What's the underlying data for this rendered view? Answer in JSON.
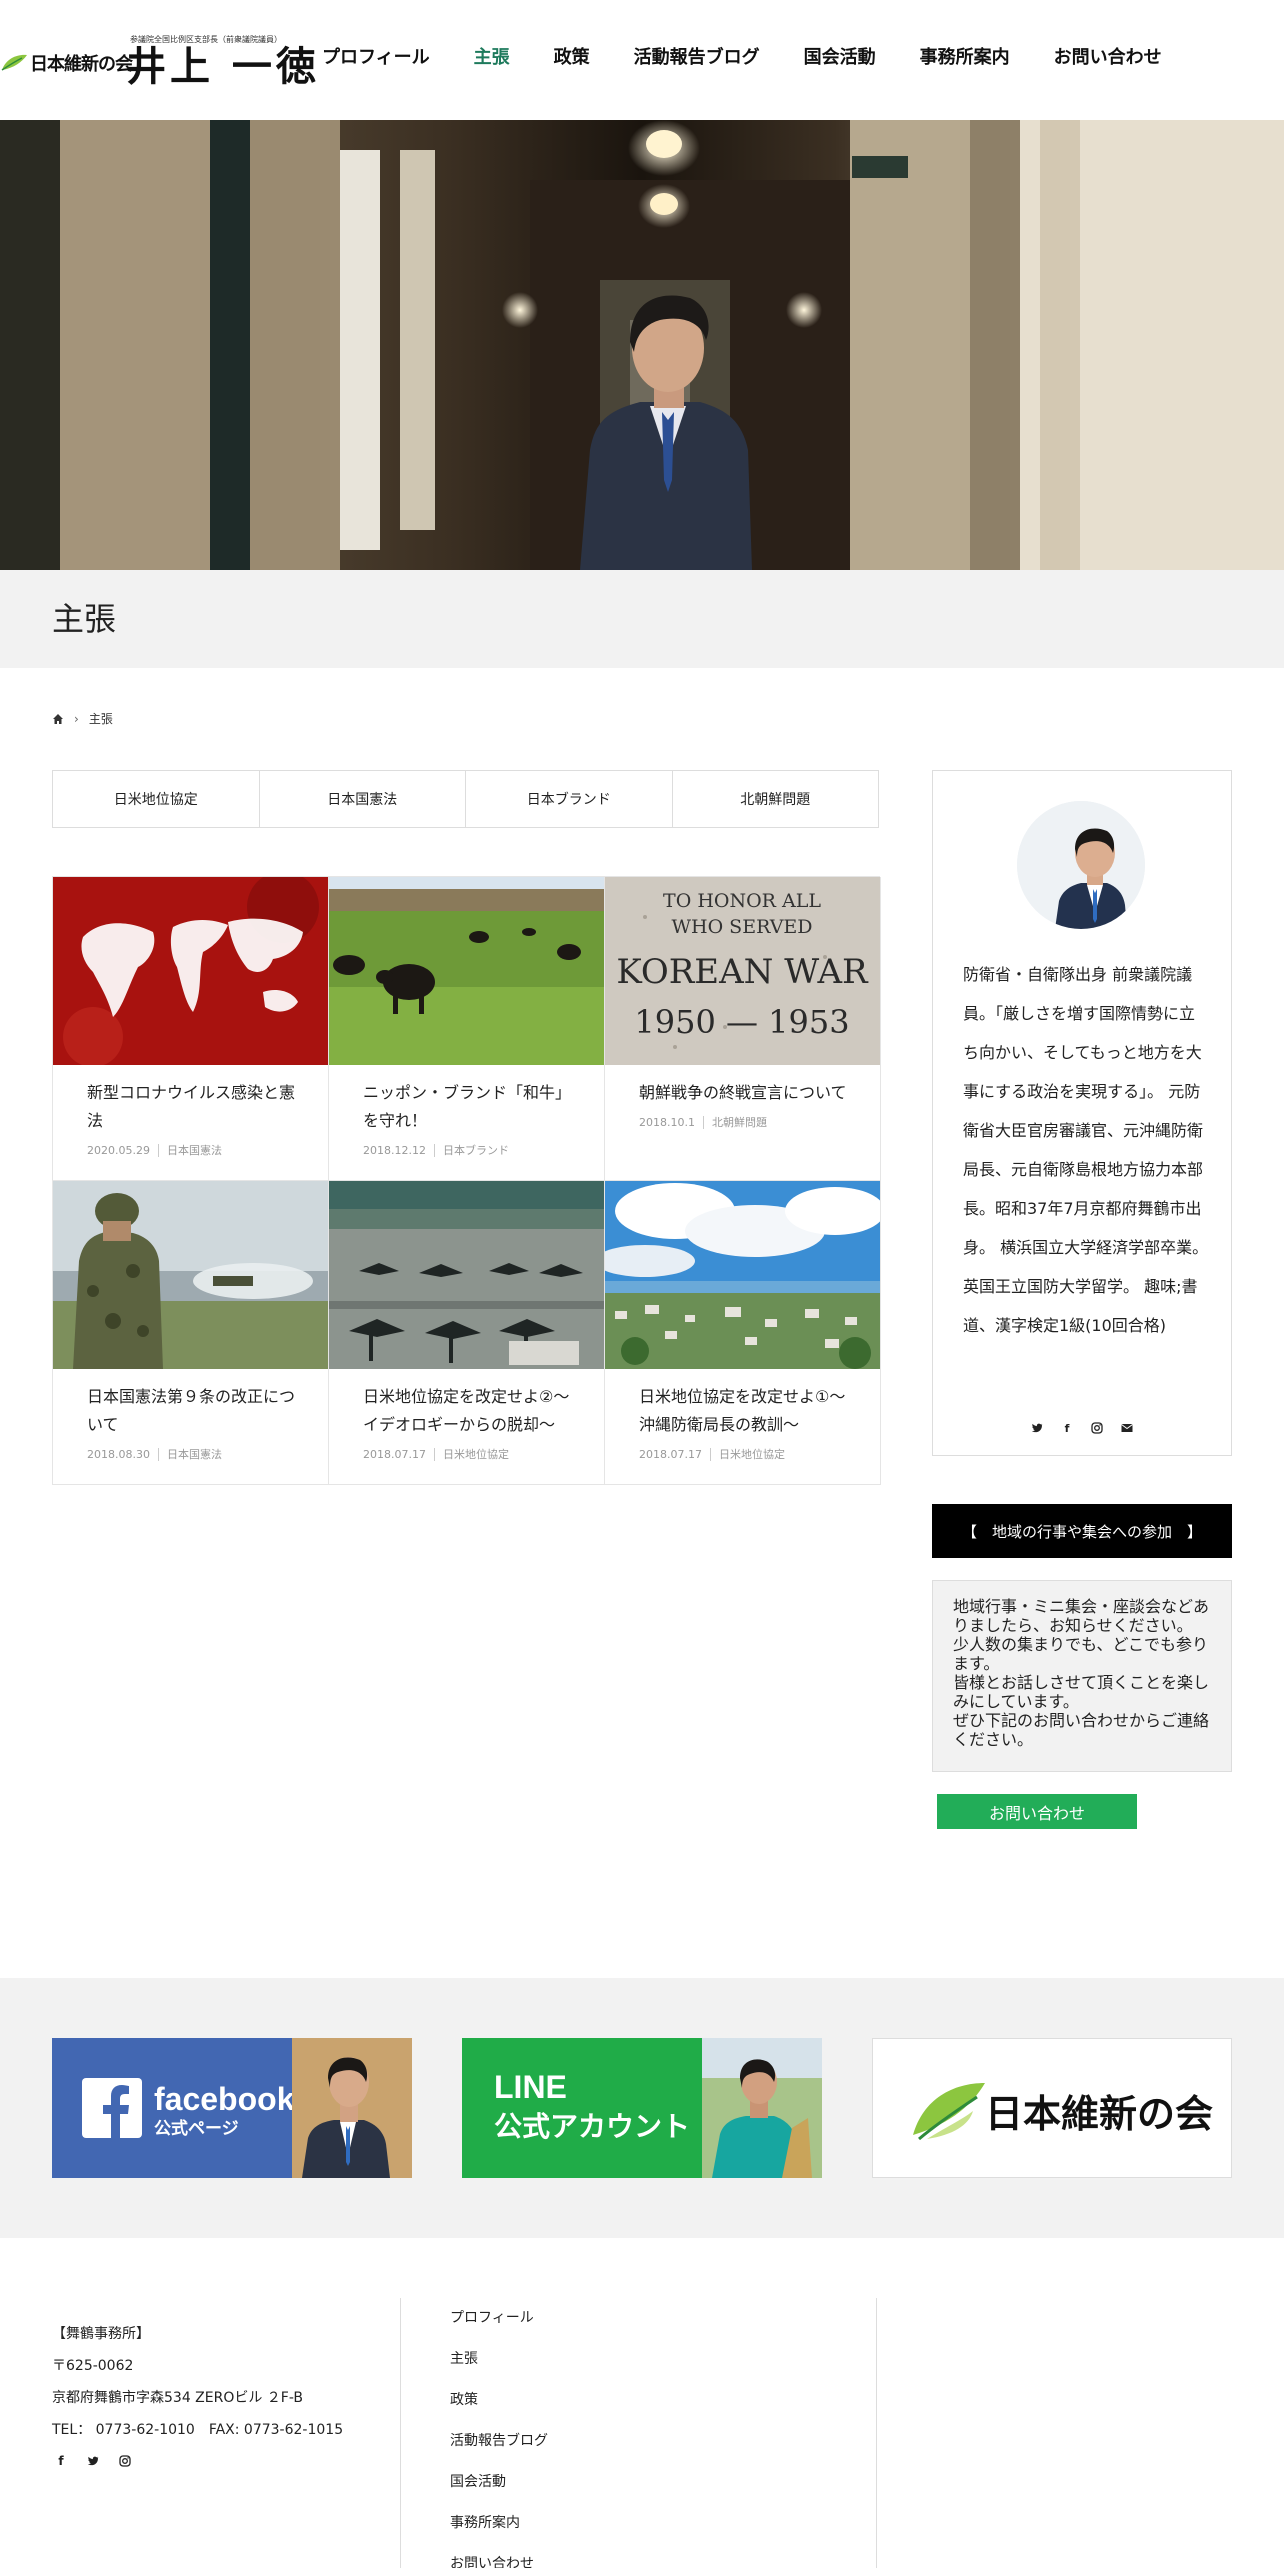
{
  "header": {
    "party_name": "日本維新の会",
    "subtitle": "参議院全国比例区支部長（前衆議院議員）",
    "politician_name": "井上 一徳",
    "nav": [
      {
        "label": "プロフィール",
        "active": false
      },
      {
        "label": "主張",
        "active": true
      },
      {
        "label": "政策",
        "active": false
      },
      {
        "label": "活動報告ブログ",
        "active": false
      },
      {
        "label": "国会活動",
        "active": false
      },
      {
        "label": "事務所案内",
        "active": false
      },
      {
        "label": "お問い合わせ",
        "active": false
      }
    ]
  },
  "page_title": "主張",
  "breadcrumb": {
    "current": "主張"
  },
  "categories": [
    "日米地位協定",
    "日本国憲法",
    "日本ブランド",
    "北朝鮮問題"
  ],
  "posts": [
    {
      "title": "新型コロナウイルス感染と憲法",
      "date": "2020.05.29",
      "category": "日本国憲法",
      "image": "covid-map"
    },
    {
      "title": "ニッポン・ブランド「和牛」を守れ！",
      "date": "2018.12.12",
      "category": "日本ブランド",
      "image": "cattle"
    },
    {
      "title": "朝鮮戦争の終戦宣言について",
      "date": "2018.10.1",
      "category": "北朝鮮問題",
      "image": "korean-war-memorial",
      "image_text": [
        "TO HONOR ALL",
        "WHO SERVED",
        "KOREAN WAR",
        "1950 — 1953"
      ]
    },
    {
      "title": "日本国憲法第９条の改正について",
      "date": "2018.08.30",
      "category": "日本国憲法",
      "image": "soldier"
    },
    {
      "title": "日米地位協定を改定せよ②～イデオロギーからの脱却～",
      "date": "2018.07.17",
      "category": "日米地位協定",
      "image": "airbase"
    },
    {
      "title": "日米地位協定を改定せよ①～沖縄防衛局長の教訓～",
      "date": "2018.07.17",
      "category": "日米地位協定",
      "image": "okinawa"
    }
  ],
  "sidebar": {
    "bio": "防衛省・自衛隊出身 前衆議院議員。「厳しさを増す国際情勢に立ち向かい、そしてもっと地方を大事にする政治を実現する」。 元防衛省大臣官房審議官、元沖縄防衛局長、元自衛隊島根地方協力本部長。昭和37年7月京都府舞鶴市出身。 横浜国立大学経済学部卒業。英国王立国防大学留学。 趣味;書道、漢字検定1級(10回合格)",
    "social_icons": [
      "twitter-icon",
      "facebook-icon",
      "instagram-icon",
      "mail-icon"
    ],
    "events_heading": "【　地域の行事や集会への参加　】",
    "events_text": [
      "地域行事・ミニ集会・座談会などありましたら、お知らせください。",
      "少人数の集まりでも、どこでも参ります。",
      "皆様とお話しさせて頂くことを楽しみにしています。",
      "ぜひ下記のお問い合わせからご連絡ください。"
    ],
    "contact_button": "お問い合わせ"
  },
  "banners": {
    "facebook": {
      "line1": "facebook",
      "line2": "公式ページ"
    },
    "line": {
      "line1": "LINE",
      "line2": "公式アカウント"
    },
    "ishin": {
      "text": "日本維新の会"
    }
  },
  "footer": {
    "office_label": "【舞鶴事務所】",
    "postal": "〒625-0062",
    "address": "京都府舞鶴市字森534 ZEROビル ２F-B",
    "phone": "TEL： 0773-62-1010　FAX: 0773-62-1015",
    "nav": [
      "プロフィール",
      "主張",
      "政策",
      "活動報告ブログ",
      "国会活動",
      "事務所案内",
      "お問い合わせ"
    ]
  },
  "colors": {
    "accent": "#1e7a5c",
    "contact_button": "#22ad58",
    "facebook": "#4267b2",
    "line": "#20ac48"
  }
}
